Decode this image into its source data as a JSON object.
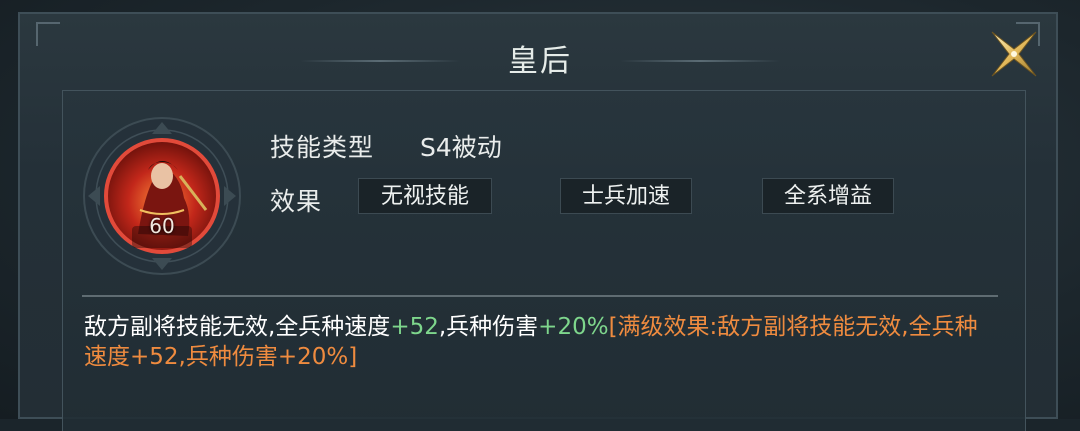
{
  "dialog": {
    "title": "皇后",
    "close_icon": "close-x-icon"
  },
  "hero": {
    "level": "60"
  },
  "skill": {
    "type_label": "技能类型",
    "type_value": "S4被动",
    "effect_label": "效果",
    "tags": [
      "无视技能",
      "士兵加速",
      "全系增益"
    ]
  },
  "description": {
    "part1": "敌方副将技能无效,全兵种速度",
    "speed_bonus": "+52",
    "part2": ",兵种伤害",
    "damage_bonus": "+20%",
    "max_level": "[满级效果:敌方副将技能无效,全兵种速度+52,兵种伤害+20%]"
  },
  "colors": {
    "green": "#7ed68c",
    "orange": "#ef8b3f"
  }
}
